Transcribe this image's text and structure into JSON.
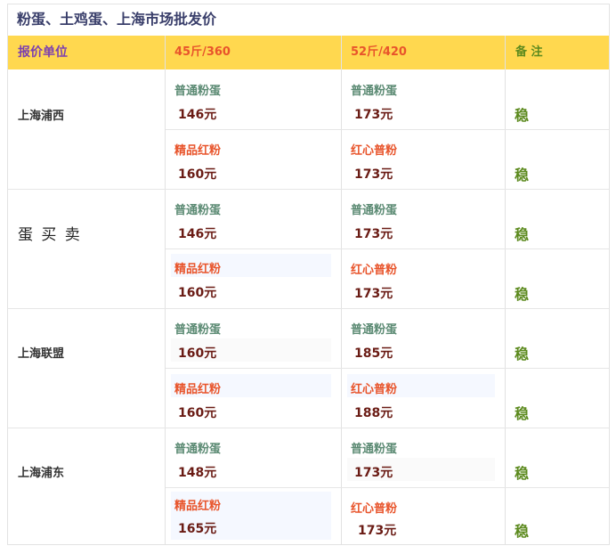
{
  "title": "粉蛋、土鸡蛋、上海市场批发价",
  "header": {
    "unit_label": "报价单位",
    "col1": "45斤/360",
    "col2": "52斤/420",
    "note": "备 注"
  },
  "colors": {
    "header_bg": "#ffd84f",
    "header_unit_text": "#7b3fb0",
    "header_col_text": "#e8542b",
    "header_note_text": "#5c8a1e",
    "type_green": "#5b8a73",
    "type_red": "#e8542b",
    "price_text": "#6a1b14",
    "note_text": "#5c8a1e"
  },
  "rows": [
    {
      "unit": "上海浦西",
      "sub": [
        {
          "a_type": "普通粉蛋",
          "a_price": "146元",
          "b_type": "普通粉蛋",
          "b_price": "173元",
          "note": "稳"
        },
        {
          "a_type": "精品红粉",
          "a_price": "160元",
          "b_type": "红心普粉",
          "b_price": "173元",
          "note": "稳"
        }
      ]
    },
    {
      "unit": "蛋 买 卖",
      "sub": [
        {
          "a_type": "普通粉蛋",
          "a_price": "146元",
          "b_type": "普通粉蛋",
          "b_price": "173元",
          "note": "稳"
        },
        {
          "a_type": "精品红粉",
          "a_price": "160元",
          "b_type": "红心普粉",
          "b_price": "173元",
          "note": "稳"
        }
      ]
    },
    {
      "unit": "上海联盟",
      "sub": [
        {
          "a_type": "普通粉蛋",
          "a_price": "160元",
          "b_type": "普通粉蛋",
          "b_price": "185元",
          "note": "稳"
        },
        {
          "a_type": "精品红粉",
          "a_price": "160元",
          "b_type": "红心普粉",
          "b_price": "188元",
          "note": "稳"
        }
      ]
    },
    {
      "unit": "上海浦东",
      "sub": [
        {
          "a_type": "普通粉蛋",
          "a_price": "148元",
          "b_type": "普通粉蛋",
          "b_price": "173元",
          "note": "稳"
        },
        {
          "a_type": "精品红粉",
          "a_price": "165元",
          "b_type": "红心普粉",
          "b_price": "173元",
          "note": "稳"
        }
      ]
    }
  ]
}
